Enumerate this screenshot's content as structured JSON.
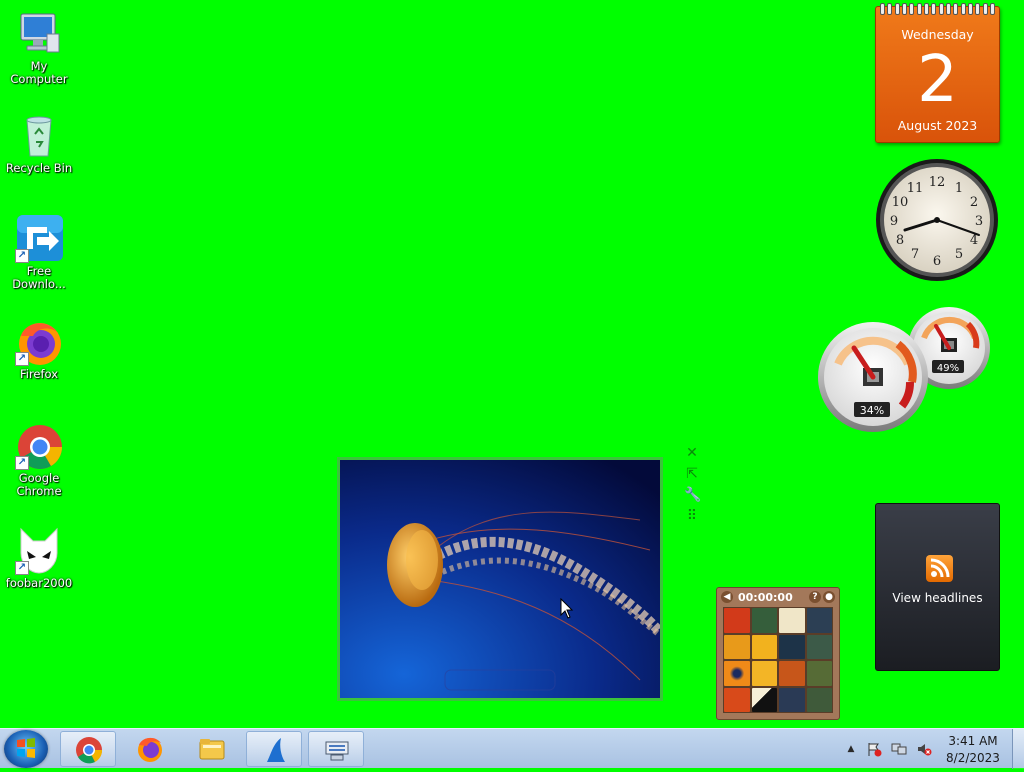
{
  "desktop": {
    "icons": [
      {
        "label": "My Computer"
      },
      {
        "label": "Recycle Bin"
      },
      {
        "label": "Free Downlo..."
      },
      {
        "label": "Firefox"
      },
      {
        "label": "Google Chrome"
      },
      {
        "label": "foobar2000"
      }
    ]
  },
  "calendar": {
    "weekday": "Wednesday",
    "day": "2",
    "month_year": "August 2023"
  },
  "cpu_meter": {
    "cpu_percent_label": "34%",
    "memory_percent_label": "49%"
  },
  "headlines": {
    "label": "View headlines"
  },
  "puzzle": {
    "timer": "00:00:00"
  },
  "taskbar": {
    "time": "3:41 AM",
    "date": "8/2/2023",
    "tray_overflow": "▲"
  },
  "colors": {
    "desktop_background": "#00ff00",
    "calendar_orange": "#e8650e",
    "taskbar": "#b6cde9"
  }
}
